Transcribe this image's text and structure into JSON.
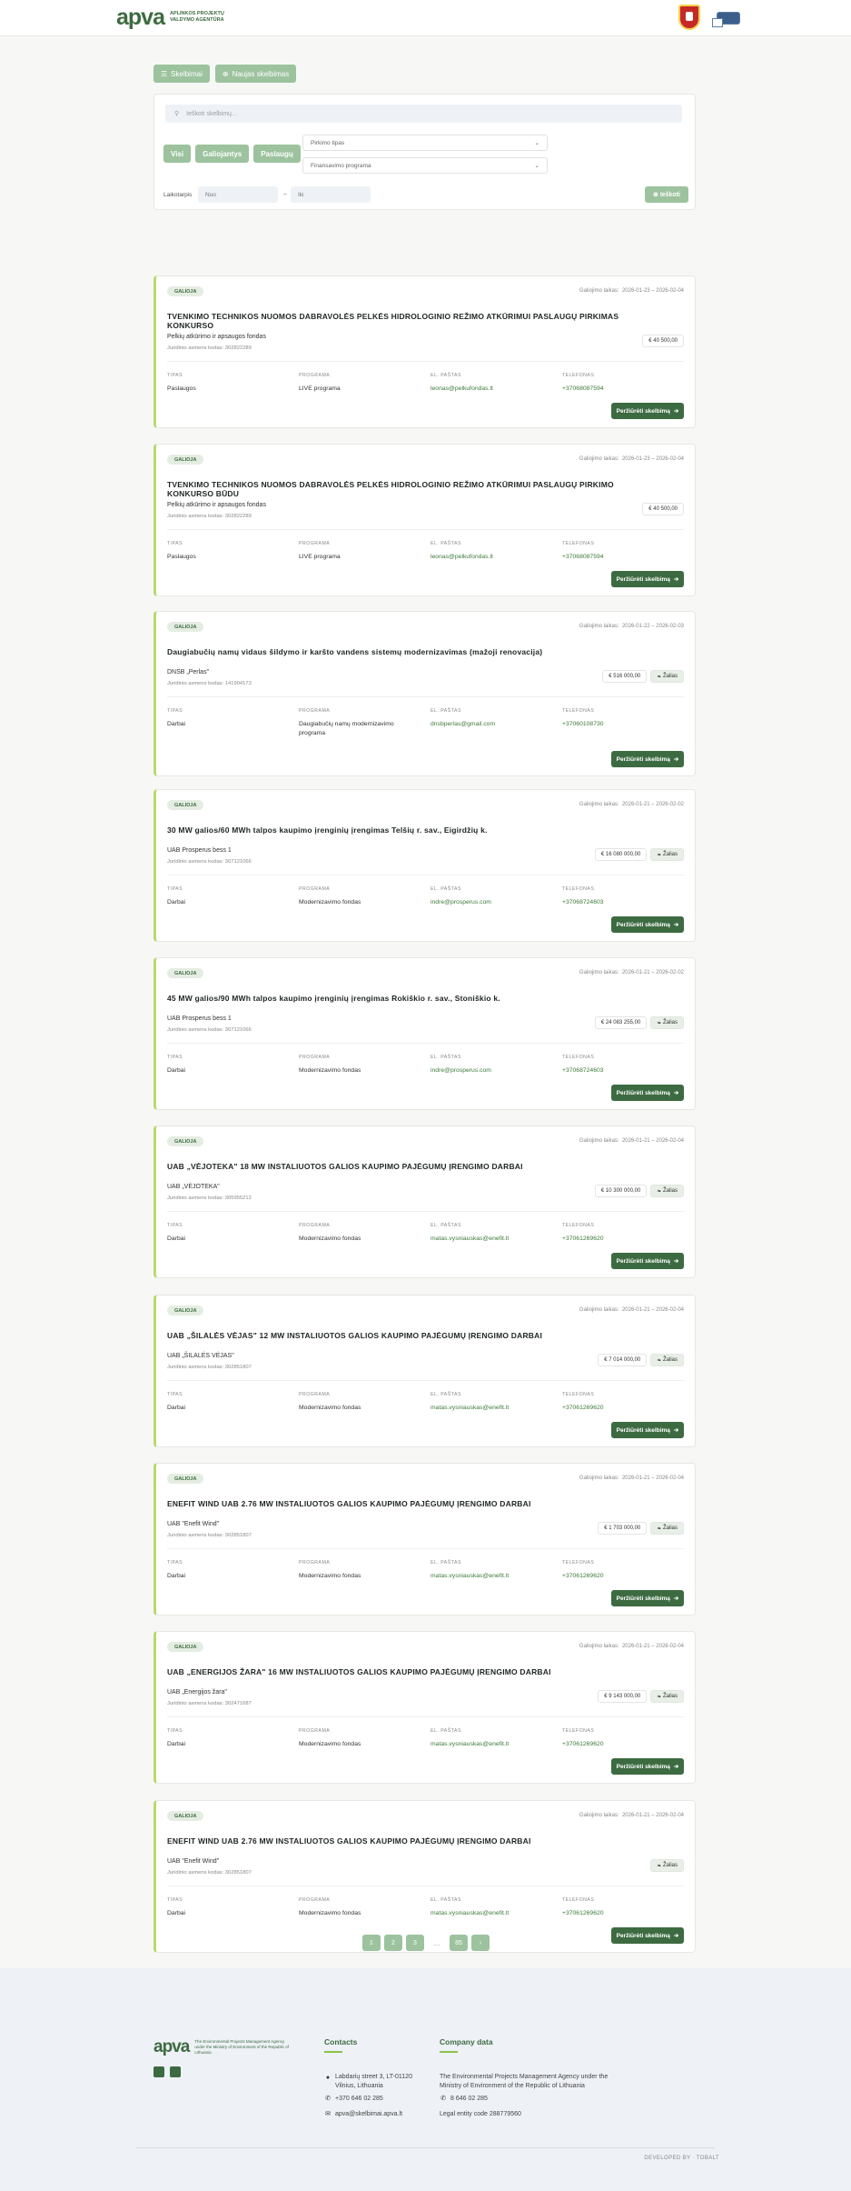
{
  "header": {
    "logo_word": "apva",
    "logo_sub": "APLINKOS PROJEKTŲ VALDYMO AGENTŪRA"
  },
  "toolbar": {
    "tab1": "Skelbimai",
    "tab2": "Naujas skelbimas"
  },
  "filters": {
    "search_placeholder": "Ieškoti skelbimų...",
    "types": [
      "Visi",
      "Galiojantys",
      "Paslaugų"
    ],
    "select1": "Pirkimo tipas",
    "select2": "Finansavimo programa",
    "date_label": "Laikotarpis",
    "from": "Nuo",
    "to": "Iki",
    "apply": "Ieškoti"
  },
  "labels": {
    "type": "TIPAS",
    "program": "PROGRAMA",
    "email": "EL. PAŠTAS",
    "phone": "TELEFONAS",
    "more": "Peržiūrėti skelbimą",
    "deadline": "Galiojimo laikas:"
  },
  "cards": [
    {
      "badge": "GALIOJA",
      "deadline": "2026-01-23 – 2026-02-04",
      "title": "TVENKIMO TECHNIKOS NUOMOS DABRAVOLĖS PELKĖS HIDROLOGINIO REŽIMO ATKŪRIMUI PASLAUGŲ PIRKIMAS KONKURSO",
      "org": "Pelkių atkūrimo ir apsaugos fondas",
      "code": "Juridinio asmens kodas: 302822289",
      "amount": "€ 40 500,00",
      "green": "",
      "type": "Paslaugos",
      "program": "LIVE programa",
      "email": "leonas@pelkufondas.lt",
      "phone": "+37068087594"
    },
    {
      "badge": "GALIOJA",
      "deadline": "2026-01-23 – 2026-02-04",
      "title": "TVENKIMO TECHNIKOS NUOMOS DABRAVOLĖS PELKĖS HIDROLOGINIO REŽIMO ATKŪRIMUI PASLAUGŲ PIRKIMO KONKURSO BŪDU",
      "org": "Pelkių atkūrimo ir apsaugos fondas",
      "code": "Juridinio asmens kodas: 302822289",
      "amount": "€ 40 500,00",
      "green": "",
      "type": "Paslaugos",
      "program": "LIVE programa",
      "email": "leonas@pelkufondas.lt",
      "phone": "+37068087594"
    },
    {
      "badge": "GALIOJA",
      "deadline": "2026-01-22 – 2026-02-03",
      "title": "Daugiabučių namų vidaus šildymo ir karšto vandens sistemų modernizavimas (mažoji renovacija)",
      "org": "DNSB „Perlas\"",
      "code": "Juridinio asmens kodas: 141904173",
      "amount": "€ 516 000,00",
      "green": "Žalias",
      "type": "Darbai",
      "program": "Daugiabučių namų modernizavimo programa",
      "email": "dnsbperlas@gmail.com",
      "phone": "+37060108730"
    },
    {
      "badge": "GALIOJA",
      "deadline": "2026-01-21 – 2026-02-02",
      "title": "30 MW galios/60 MWh talpos kaupimo įrenginių įrengimas Telšių r. sav., Eigirdžių k.",
      "org": "UAB Prosperus bess 1",
      "code": "Juridinio asmens kodas: 307121066",
      "amount": "€ 16 080 000,00",
      "green": "Žalias",
      "type": "Darbai",
      "program": "Modernizavimo fondas",
      "email": "indre@prosperus.com",
      "phone": "+37068724603"
    },
    {
      "badge": "GALIOJA",
      "deadline": "2026-01-21 – 2026-02-02",
      "title": "45 MW galios/90 MWh talpos kaupimo įrenginių įrengimas Rokiškio r. sav., Stoniškio k.",
      "org": "UAB Prosperus bess 1",
      "code": "Juridinio asmens kodas: 307121066",
      "amount": "€ 24 083 255,00",
      "green": "Žalias",
      "type": "Darbai",
      "program": "Modernizavimo fondas",
      "email": "indre@prosperus.com",
      "phone": "+37068724603"
    },
    {
      "badge": "GALIOJA",
      "deadline": "2026-01-21 – 2026-02-04",
      "title": "UAB „VĖJOTEKA\" 18 MW INSTALIUOTOS GALIOS KAUPIMO PAJĖGUMŲ ĮRENGIMO DARBAI",
      "org": "UAB „VĖJOTEKA\"",
      "code": "Juridinio asmens kodas: 305955212",
      "amount": "€ 10 300 000,00",
      "green": "Žalias",
      "type": "Darbai",
      "program": "Modernizavimo fondas",
      "email": "matas.vysniauskas@enefit.lt",
      "phone": "+37061269620"
    },
    {
      "badge": "GALIOJA",
      "deadline": "2026-01-21 – 2026-02-04",
      "title": "UAB „ŠILALĖS VĖJAS\" 12 MW INSTALIUOTOS GALIOS KAUPIMO PAJĖGUMŲ ĮRENGIMO DARBAI",
      "org": "UAB „ŠILALĖS VĖJAS\"",
      "code": "Juridinio asmens kodas: 302851807",
      "amount": "€ 7 014 000,00",
      "green": "Žalias",
      "type": "Darbai",
      "program": "Modernizavimo fondas",
      "email": "matas.vysniauskas@enefit.lt",
      "phone": "+37061269620"
    },
    {
      "badge": "GALIOJA",
      "deadline": "2026-01-21 – 2026-02-04",
      "title": "ENEFIT WIND UAB 2.76 MW INSTALIUOTOS GALIOS KAUPIMO PAJĖGUMŲ ĮRENGIMO DARBAI",
      "org": "UAB \"Enefit Wind\"",
      "code": "Juridinio asmens kodas: 302851807",
      "amount": "€ 1 703 000,00",
      "green": "Žalias",
      "type": "Darbai",
      "program": "Modernizavimo fondas",
      "email": "matas.vysniauskas@enefit.lt",
      "phone": "+37061269620"
    },
    {
      "badge": "GALIOJA",
      "deadline": "2026-01-21 – 2026-02-04",
      "title": "UAB „ENERGIJOS ŽARA\" 16 MW INSTALIUOTOS GALIOS KAUPIMO PAJĖGUMŲ ĮRENGIMO DARBAI",
      "org": "UAB „Energijos žara\"",
      "code": "Juridinio asmens kodas: 302471687",
      "amount": "€ 9 143 000,00",
      "green": "Žalias",
      "type": "Darbai",
      "program": "Modernizavimo fondas",
      "email": "matas.vysniauskas@enefit.lt",
      "phone": "+37061269620"
    },
    {
      "badge": "GALIOJA",
      "deadline": "2026-01-21 – 2026-02-04",
      "title": "ENEFIT WIND UAB 2.76 MW INSTALIUOTOS GALIOS KAUPIMO PAJĖGUMŲ ĮRENGIMO DARBAI",
      "org": "UAB \"Enefit Wind\"",
      "code": "Juridinio asmens kodas: 302851807",
      "amount": "",
      "green": "Žalias",
      "type": "Darbai",
      "program": "Modernizavimo fondas",
      "email": "matas.vysniauskas@enefit.lt",
      "phone": "+37061269620"
    }
  ],
  "pager": {
    "p1": "1",
    "p2": "2",
    "p3": "3",
    "dots": "...",
    "last": "85",
    "next": "›"
  },
  "footer": {
    "logo_word": "apva",
    "logo_sub": "The Environmental Projects Management Agency under the Ministry of Environment of the Republic of Lithuania",
    "contacts_title": "Contacts",
    "address": "Labdarių street 3, LT-01120 Vilnius, Lithuania",
    "phone": "+370 646 02 285",
    "email": "apva@skelbimai.apva.lt",
    "company_title": "Company data",
    "company_desc": "The Environmental Projects Management Agency under the Ministry of Environment of the Republic of Lithuania",
    "company_phone": "8 646 02 285",
    "entity": "Legal entity code 288779560",
    "dev": "DEVELOPED BY · TOBALT"
  }
}
